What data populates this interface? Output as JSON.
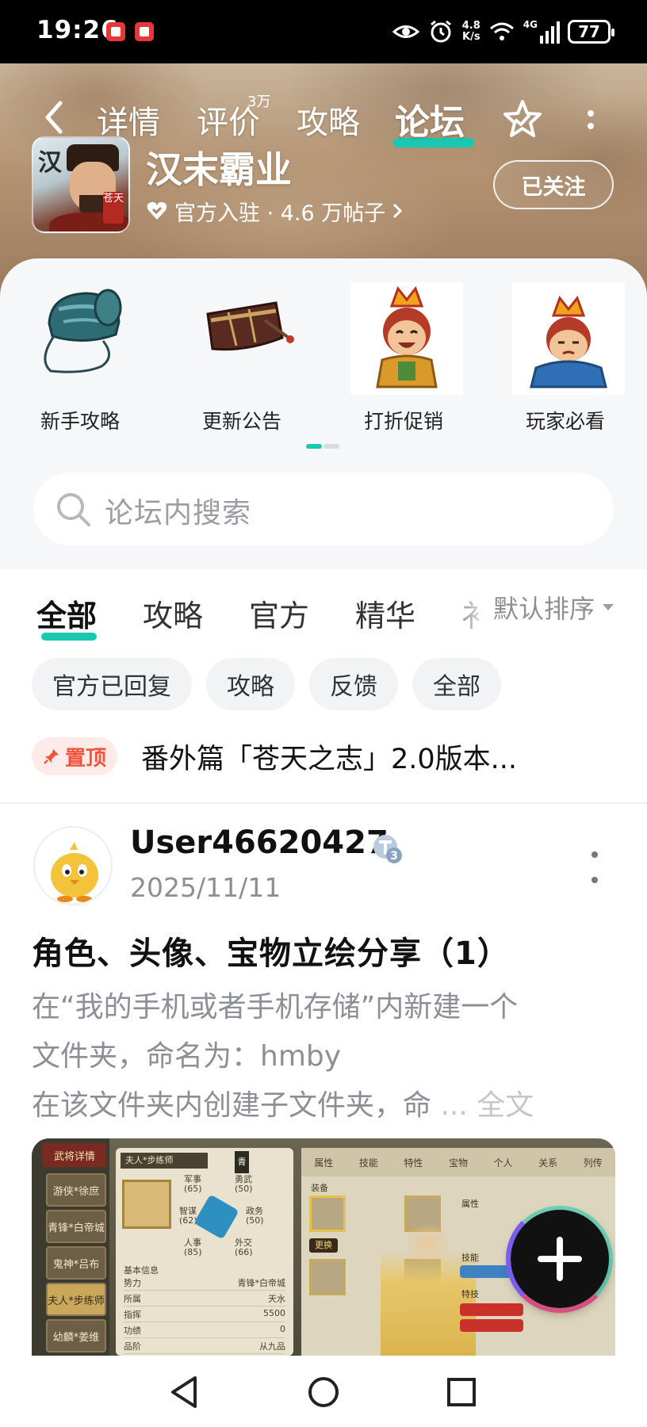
{
  "status_bar": {
    "time": "19:26",
    "net_speed_value": "4.8",
    "net_speed_unit": "K/s",
    "network": "4G",
    "battery": "77"
  },
  "header": {
    "nav_tabs": [
      {
        "label": "详情"
      },
      {
        "label": "评价",
        "sup": "3万"
      },
      {
        "label": "攻略"
      },
      {
        "label": "论坛",
        "active": true
      }
    ],
    "app_name": "汉末霸业",
    "icon_char": "汉",
    "icon_seal": "苍天",
    "meta": "官方入驻 · 4.6 万帖子",
    "follow_label": "已关注"
  },
  "categories": [
    {
      "label": "新手攻略",
      "icon": "hat-icon"
    },
    {
      "label": "更新公告",
      "icon": "crown-icon"
    },
    {
      "label": "打折促销",
      "icon": "laughing-character-icon"
    },
    {
      "label": "玩家必看",
      "icon": "sleepy-character-icon"
    }
  ],
  "search": {
    "placeholder": "论坛内搜索"
  },
  "filter_tabs": [
    "全部",
    "攻略",
    "官方",
    "精华",
    "衤"
  ],
  "sort_label": "默认排序",
  "chips": [
    "官方已回复",
    "攻略",
    "反馈",
    "全部"
  ],
  "pinned": {
    "badge": "置顶",
    "title": "番外篇「苍天之志」2.0版本..."
  },
  "post": {
    "username": "User46620427",
    "level": "3",
    "date": "2025/11/11",
    "title": "角色、头像、宝物立绘分享（1）",
    "body_lines": [
      "在“我的手机或者手机存储”内新建一个",
      "文件夹，命名为：hmby",
      "在该文件夹内创建子文件夹，命"
    ],
    "more_label": "... 全文",
    "image": {
      "sidebar_title": "武将详情",
      "sidebar_items": [
        "游侠*徐庶",
        "青锋*白帝城",
        "鬼神*吕布",
        "夫人*步练师",
        "幼麟*姜维"
      ],
      "panel_name": "夫人*步练师",
      "panel_badge": "青",
      "stats": [
        {
          "label": "军事",
          "value": "(65)"
        },
        {
          "label": "勇武",
          "value": "(50)"
        },
        {
          "label": "智谋",
          "value": "(62)"
        },
        {
          "label": "政务",
          "value": "(50)"
        },
        {
          "label": "人事",
          "value": "(85)"
        },
        {
          "label": "外交",
          "value": "(66)"
        }
      ],
      "info_header": "基本信息",
      "info_rows": [
        {
          "k": "势力",
          "v": "青锋*白帝城"
        },
        {
          "k": "所属",
          "v": "天水"
        },
        {
          "k": "指挥",
          "v": "5500"
        },
        {
          "k": "功绩",
          "v": "0"
        },
        {
          "k": "品阶",
          "v": "从九品"
        }
      ],
      "right_tabs": [
        "属性",
        "技能",
        "特性",
        "宝物",
        "个人",
        "关系",
        "列传"
      ],
      "equip_label": "装备",
      "change_label": "更换",
      "side_labels": [
        "属性",
        "技能",
        "特技"
      ]
    }
  },
  "colors": {
    "accent": "#18c8b0",
    "pin_red": "#f0553b",
    "muted": "#8c9096"
  }
}
